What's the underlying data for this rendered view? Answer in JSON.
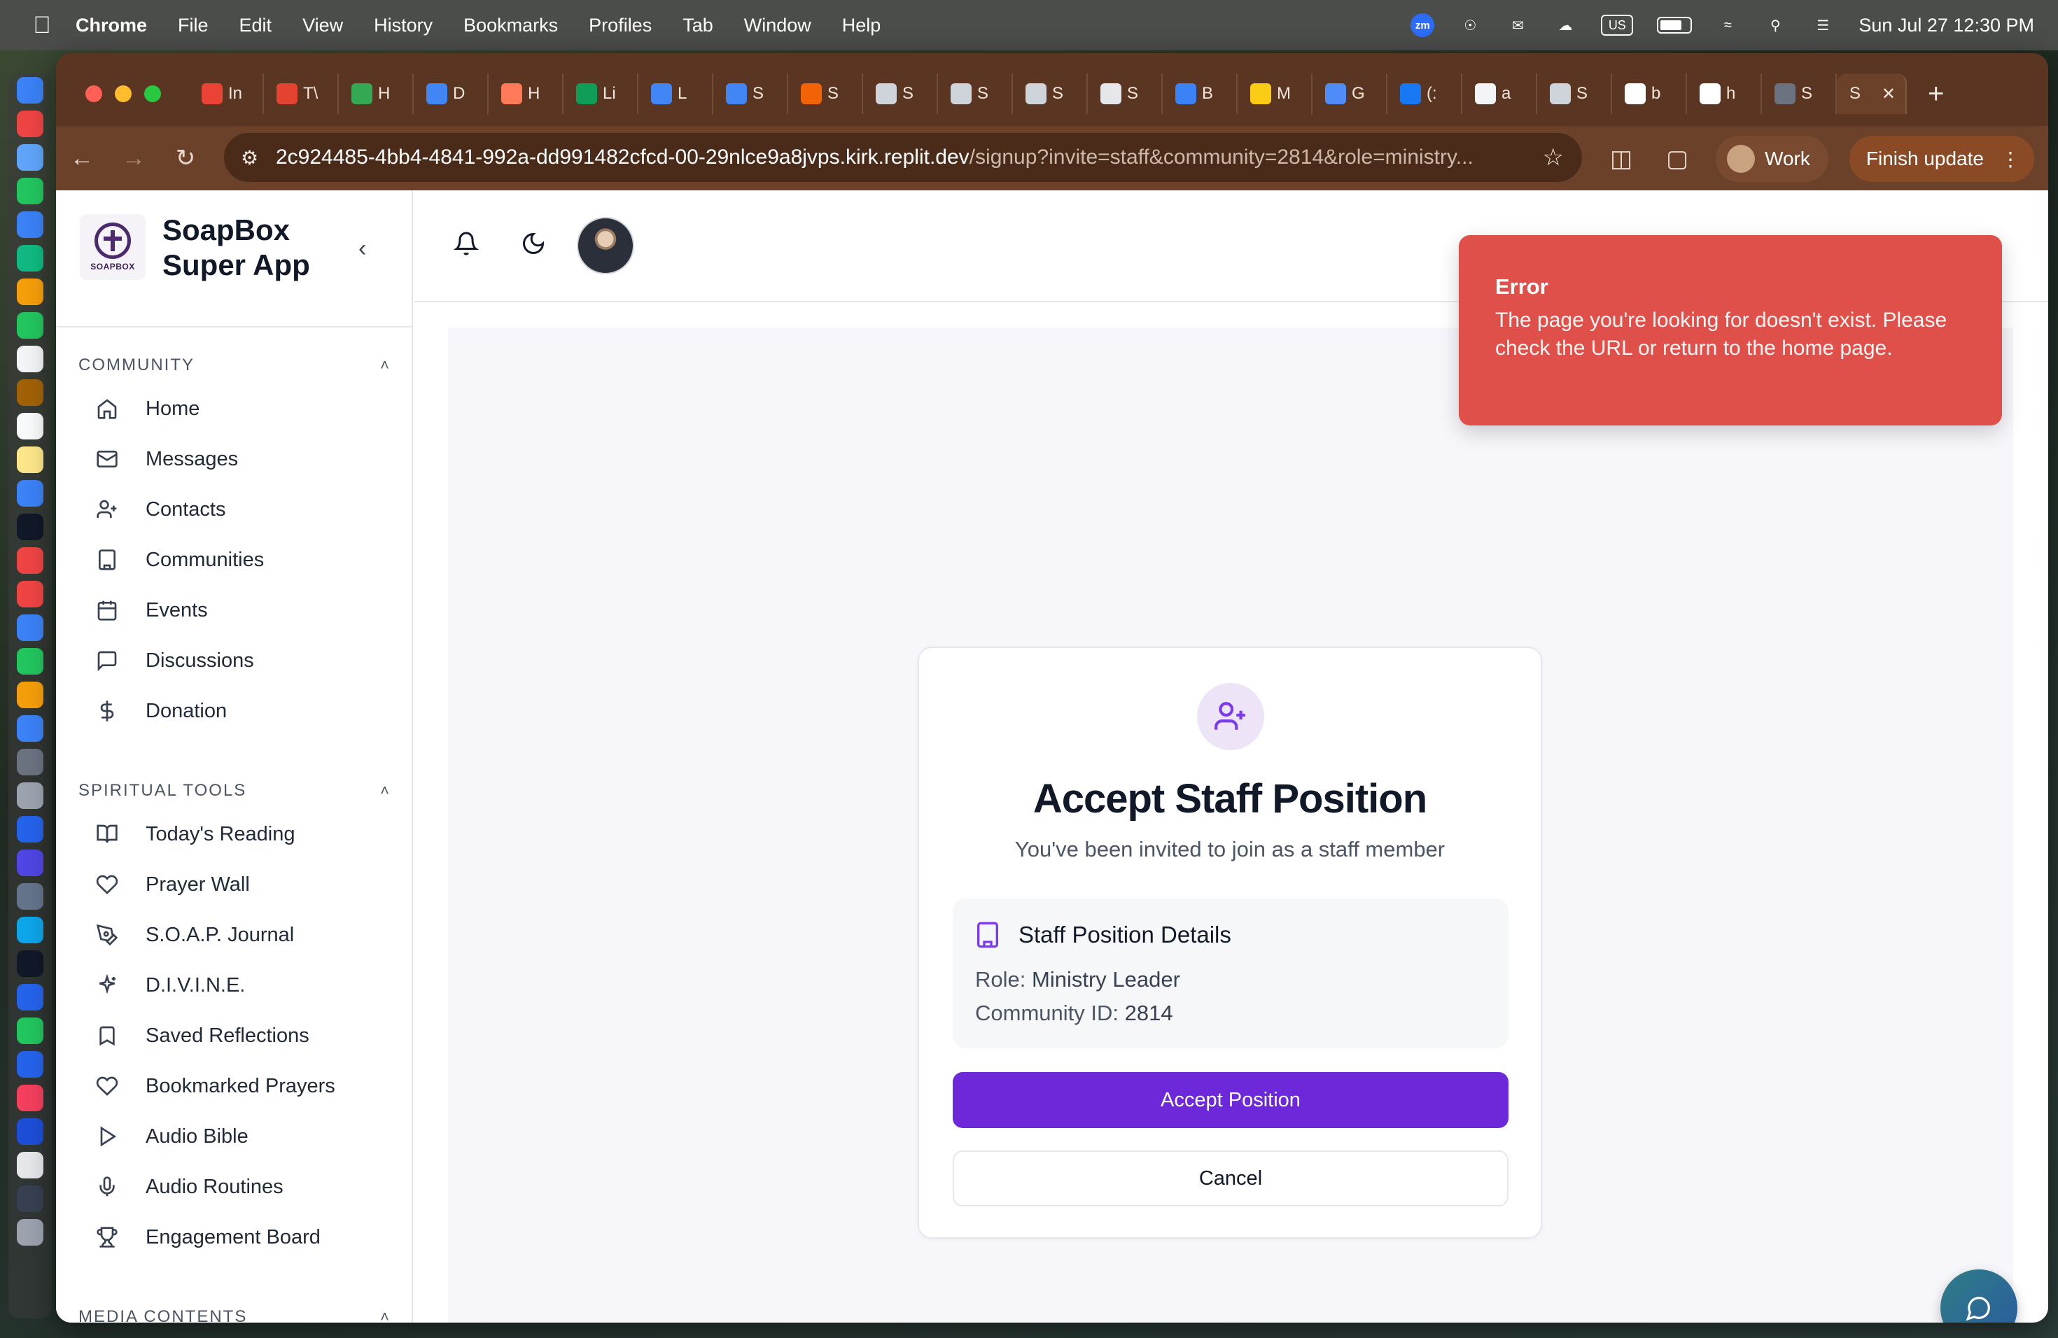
{
  "menubar": {
    "app_name": "Chrome",
    "items": [
      "File",
      "Edit",
      "View",
      "History",
      "Bookmarks",
      "Profiles",
      "Tab",
      "Window",
      "Help"
    ],
    "status": {
      "zoom_label": "zm",
      "keyboard": "US",
      "datetime": "Sun Jul 27  12:30 PM"
    }
  },
  "browser": {
    "tabs": [
      {
        "label": "In",
        "icon": "gmail-icon",
        "color": "#ea4335"
      },
      {
        "label": "T\\",
        "icon": "todoist-icon",
        "color": "#e44332"
      },
      {
        "label": "H",
        "icon": "drive-icon",
        "color": "#34a853"
      },
      {
        "label": "D",
        "icon": "docs-icon",
        "color": "#4285f4"
      },
      {
        "label": "H",
        "icon": "hubspot-icon",
        "color": "#ff7a59"
      },
      {
        "label": "Li",
        "icon": "sheets-icon",
        "color": "#0f9d58"
      },
      {
        "label": "L",
        "icon": "docs-icon",
        "color": "#4285f4"
      },
      {
        "label": "S",
        "icon": "docs-icon",
        "color": "#4285f4"
      },
      {
        "label": "S",
        "icon": "replit-icon",
        "color": "#f26207"
      },
      {
        "label": "S",
        "icon": "globe-icon",
        "color": "#cfd4da"
      },
      {
        "label": "S",
        "icon": "globe-icon",
        "color": "#cfd4da"
      },
      {
        "label": "S",
        "icon": "globe-icon",
        "color": "#cfd4da"
      },
      {
        "label": "S",
        "icon": "openai-icon",
        "color": "#e5e7eb"
      },
      {
        "label": "B",
        "icon": "bolt-icon",
        "color": "#3b82f6"
      },
      {
        "label": "M",
        "icon": "emblem-icon",
        "color": "#facc15"
      },
      {
        "label": "G",
        "icon": "gemini-icon",
        "color": "#4f8cf7"
      },
      {
        "label": "(:",
        "icon": "facebook-icon",
        "color": "#1877f2"
      },
      {
        "label": "a",
        "icon": "github-icon",
        "color": "#f3f4f6"
      },
      {
        "label": "S",
        "icon": "globe-icon",
        "color": "#cfd4da"
      },
      {
        "label": "b",
        "icon": "google-icon",
        "color": "#ffffff"
      },
      {
        "label": "h",
        "icon": "google-icon",
        "color": "#ffffff"
      },
      {
        "label": "S",
        "icon": "shield-icon",
        "color": "#6b7280"
      }
    ],
    "active_tab_label": "S",
    "url_host": "2c924485-4bb4-4841-992a-dd991482cfcd-00-29nlce9a8jvps.kirk.replit.dev",
    "url_path": "/signup?invite=staff&community=2814&role=ministry...",
    "profile_label": "Work",
    "update_label": "Finish update"
  },
  "sidebar": {
    "app_title_line1": "SoapBox",
    "app_title_line2": "Super App",
    "logo_text": "SOAPBOX",
    "sections": [
      {
        "title": "COMMUNITY",
        "items": [
          {
            "label": "Home",
            "icon": "home-icon"
          },
          {
            "label": "Messages",
            "icon": "mail-icon"
          },
          {
            "label": "Contacts",
            "icon": "user-plus-icon"
          },
          {
            "label": "Communities",
            "icon": "building-icon"
          },
          {
            "label": "Events",
            "icon": "calendar-icon"
          },
          {
            "label": "Discussions",
            "icon": "message-square-icon"
          },
          {
            "label": "Donation",
            "icon": "dollar-icon"
          }
        ]
      },
      {
        "title": "SPIRITUAL TOOLS",
        "items": [
          {
            "label": "Today's Reading",
            "icon": "book-open-icon"
          },
          {
            "label": "Prayer Wall",
            "icon": "heart-icon"
          },
          {
            "label": "S.O.A.P. Journal",
            "icon": "pen-tool-icon"
          },
          {
            "label": "D.I.V.I.N.E.",
            "icon": "sparkles-icon"
          },
          {
            "label": "Saved Reflections",
            "icon": "bookmark-icon"
          },
          {
            "label": "Bookmarked Prayers",
            "icon": "heart-icon"
          },
          {
            "label": "Audio Bible",
            "icon": "play-icon"
          },
          {
            "label": "Audio Routines",
            "icon": "mic-icon"
          },
          {
            "label": "Engagement Board",
            "icon": "trophy-icon"
          }
        ]
      },
      {
        "title": "MEDIA CONTENTS",
        "items": []
      }
    ]
  },
  "toast": {
    "title": "Error",
    "message": "The page you're looking for doesn't exist. Please check the URL or return to the home page."
  },
  "card": {
    "title": "Accept Staff Position",
    "subtitle": "You've been invited to join as a staff member",
    "details_title": "Staff Position Details",
    "role_label": "Role:",
    "role_value": "Ministry Leader",
    "community_label": "Community ID:",
    "community_value": "2814",
    "accept_label": "Accept Position",
    "cancel_label": "Cancel"
  },
  "colors": {
    "primary": "#6d28d9",
    "error": "#e0504a",
    "browser_frame": "#5a3622"
  }
}
